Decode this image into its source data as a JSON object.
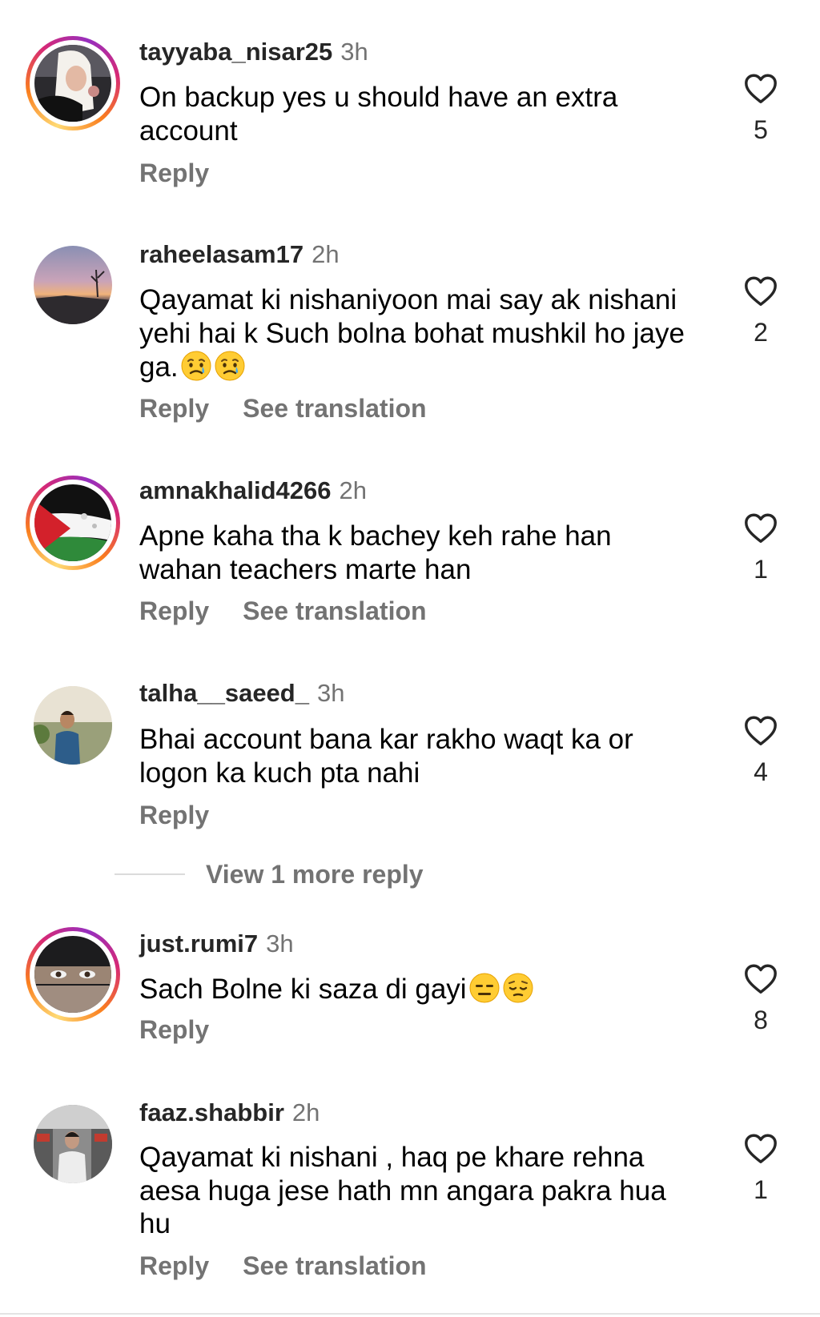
{
  "comments": [
    {
      "username": "tayyaba_nisar25",
      "time": "3h",
      "text": "On backup yes u should have an extra account",
      "reply_label": "Reply",
      "likes": "5",
      "avatar_ring": true
    },
    {
      "username": "raheelasam17",
      "time": "2h",
      "text": "Qayamat ki nishaniyoon mai say ak nishani yehi hai k Such bolna bohat mushkil ho jaye ga.",
      "emojis": [
        "crying-face-emoji",
        "crying-face-emoji"
      ],
      "reply_label": "Reply",
      "translation_label": "See translation",
      "likes": "2",
      "avatar_ring": false
    },
    {
      "username": "amnakhalid4266",
      "time": "2h",
      "text": "Apne kaha tha k bachey keh rahe han wahan teachers marte han",
      "reply_label": "Reply",
      "translation_label": "See translation",
      "likes": "1",
      "avatar_ring": true
    },
    {
      "username": "talha__saeed_",
      "time": "3h",
      "text": "Bhai account bana kar rakho waqt ka or logon ka kuch pta nahi",
      "reply_label": "Reply",
      "likes": "4",
      "avatar_ring": false
    },
    {
      "username": "just.rumi7",
      "time": "3h",
      "text": "Sach Bolne ki saza di gayi",
      "emojis": [
        "expressionless-face-emoji",
        "pensive-face-emoji"
      ],
      "reply_label": "Reply",
      "likes": "8",
      "avatar_ring": true
    },
    {
      "username": "faaz.shabbir",
      "time": "2h",
      "text": "Qayamat ki nishani , haq pe khare rehna aesa huga jese hath mn angara pakra hua hu",
      "reply_label": "Reply",
      "translation_label": "See translation",
      "likes": "1",
      "avatar_ring": false
    }
  ],
  "view_more_replies": "View 1 more reply",
  "icons": {
    "like": "heart-outline-icon"
  },
  "colors": {
    "secondary_text": "#737373",
    "primary_text": "#262626",
    "story_ring": [
      "#feda75",
      "#fa7e1e",
      "#d62976",
      "#962fbf"
    ]
  }
}
